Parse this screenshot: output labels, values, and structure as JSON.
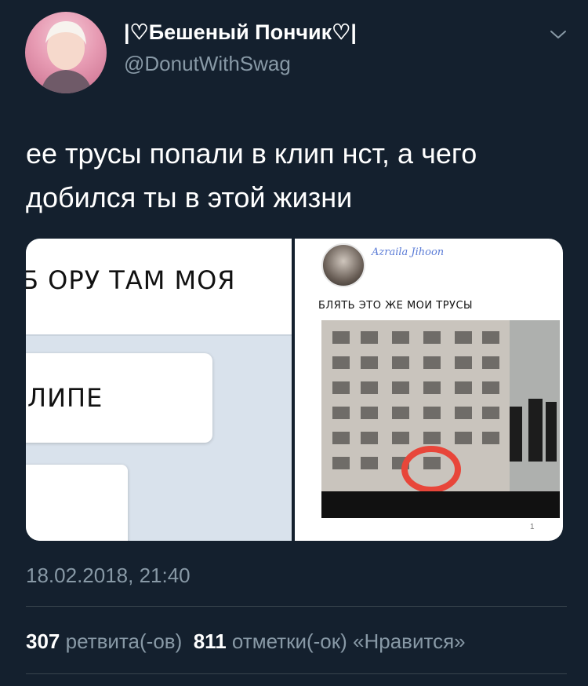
{
  "tweet": {
    "display_name": "|♡Бешеный Пончик♡|",
    "handle": "@DonutWithSwag",
    "text": "ее трусы попали в клип нст, а чего добился ты в этой жизни",
    "timestamp": "18.02.2018, 21:40",
    "retweets_count": "307",
    "retweets_label": "ретвита(-ов)",
    "likes_count": "811",
    "likes_label": "отметки(-ок) «Нравится»"
  },
  "media": {
    "left_image_text_1": "Б ОРУ ТАМ МОЯ",
    "left_image_text_2": "ЛИПЕ",
    "right_image_username": "Azraila Jihoon",
    "right_image_caption": "БЛЯТЬ ЭТО ЖЕ МОИ ТРУСЫ",
    "right_image_footer": "1"
  },
  "icons": {
    "options": "chevron-down-icon"
  },
  "colors": {
    "background": "#14202e",
    "secondary_text": "#8899a6",
    "divider": "#38444d"
  }
}
